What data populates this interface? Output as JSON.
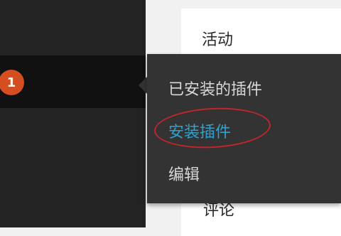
{
  "sidebar": {
    "active_item": {
      "badge_count": "1"
    }
  },
  "content": {
    "items": [
      "活动",
      "评论"
    ]
  },
  "submenu": {
    "items": [
      {
        "label": "已安装的插件"
      },
      {
        "label": "安装插件",
        "highlighted": true
      },
      {
        "label": "编辑"
      }
    ]
  },
  "colors": {
    "sidebar_bg": "#232323",
    "sidebar_active_bg": "#111111",
    "flyout_bg": "#333333",
    "badge_bg": "#d54e21",
    "link_active": "#2ea2cc",
    "highlight_ring": "#c0262c"
  }
}
